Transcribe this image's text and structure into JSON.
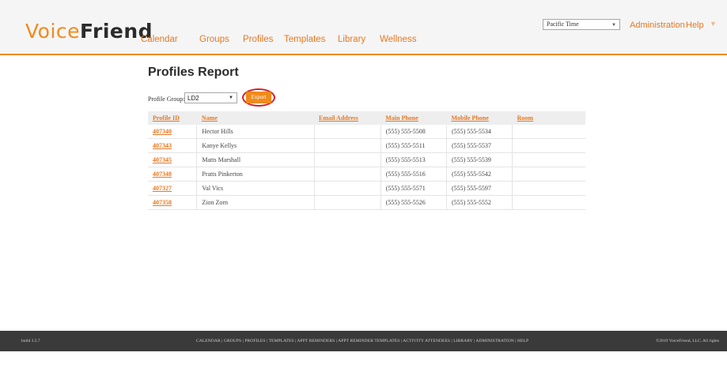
{
  "header": {
    "logo_voice": "Voice",
    "logo_friend": "Friend",
    "nav": [
      "Calendar",
      "Groups",
      "Profiles",
      "Templates",
      "Library",
      "Wellness"
    ],
    "timezone": "Pacific Time",
    "admin_label": "Administration",
    "help_label": "Help"
  },
  "main": {
    "title": "Profiles Report",
    "profile_group_label": "Profile Group:",
    "profile_group_value": "LD2",
    "export_label": "Export",
    "table": {
      "headers": [
        "Profile ID",
        "Name",
        "Email Address",
        "Main Phone",
        "Mobile Phone",
        "Room"
      ],
      "rows": [
        [
          "407340",
          "Hector Hills",
          "",
          "(555) 555-5508",
          "(555) 555-5534",
          ""
        ],
        [
          "407343",
          "Kanye Kellys",
          "",
          "(555) 555-5511",
          "(555) 555-5537",
          ""
        ],
        [
          "407345",
          "Matts Marshall",
          "",
          "(555) 555-5513",
          "(555) 555-5539",
          ""
        ],
        [
          "407348",
          "Pratts Pinkerton",
          "",
          "(555) 555-5516",
          "(555) 555-5542",
          ""
        ],
        [
          "407327",
          "Val Vics",
          "",
          "(555) 555-5571",
          "(555) 555-5597",
          ""
        ],
        [
          "407358",
          "Zion Zorn",
          "",
          "(555) 555-5526",
          "(555) 555-5552",
          ""
        ]
      ]
    }
  },
  "footer": {
    "build": "build 3.5.7",
    "links": "CALENDAR | GROUPS | PROFILES | TEMPLATES | APPT REMINDERS | APPT REMINDER TEMPLATES | ACTIVITY ATTENDEES | LIBRARY | ADMINISTRATION | HELP",
    "copyright": "©2019 VoiceFriend, LLC. All rights"
  },
  "colors": {
    "accent": "#f08a1c",
    "link": "#e87722",
    "highlight_ring": "#d81f1f",
    "footer_bg": "#3a3a3a"
  }
}
